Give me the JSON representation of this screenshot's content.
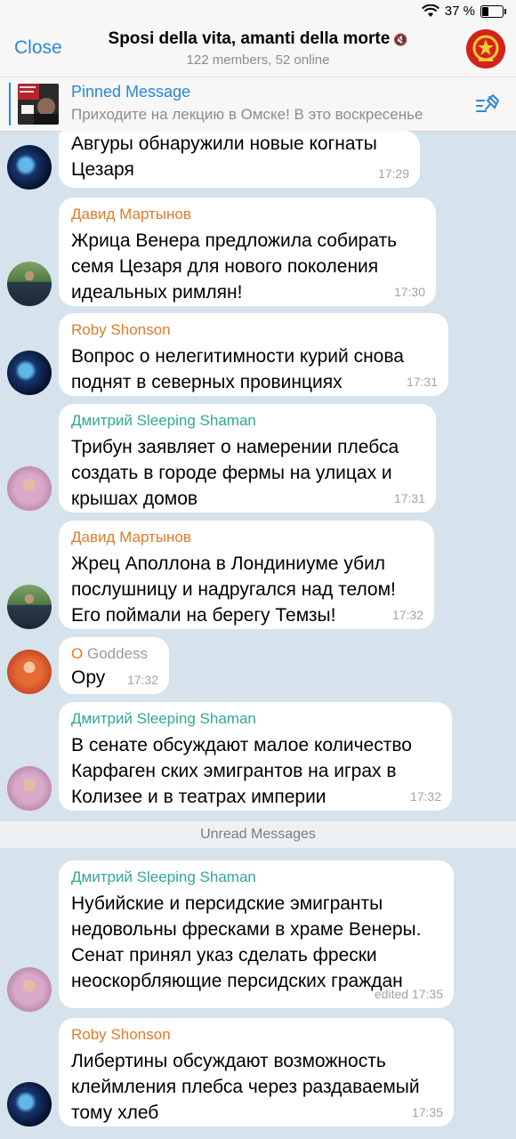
{
  "status_bar": {
    "battery": "37 %",
    "battery_level": 0.37
  },
  "header": {
    "close_label": "Close",
    "title": "Sposi della vita, amanti della morte",
    "subtitle": "122 members, 52 online"
  },
  "pinned": {
    "title": "Pinned Message",
    "text": "Приходите на лекцию в Омске! В это воскресенье"
  },
  "unread_divider": "Unread Messages",
  "messages": [
    {
      "sender": "",
      "text": "Авгуры обнаружили новые когнаты Цезаря",
      "time": "17:29"
    },
    {
      "sender": "Давид Мартынов",
      "sender_color": "#e27a2c",
      "text": "Жрица Венера предложила собирать семя Цезаря для нового поколения идеальных римлян!",
      "time": "17:30"
    },
    {
      "sender": "Roby Shonson",
      "sender_color": "#e27a2c",
      "text": "Вопрос о нелегитимности курий снова поднят в северных провинциях",
      "time": "17:31"
    },
    {
      "sender": "Дмитрий Sleeping Shaman",
      "sender_color": "#31a892",
      "text": "Трибун заявляет о намерении плебса создать в городе фермы на улицах и крышах домов",
      "time": "17:31"
    },
    {
      "sender": "Давид Мартынов",
      "sender_color": "#e27a2c",
      "text": "Жрец Аполлона в Лондиниуме убил послушницу и надругался над телом! Его поймали на берегу Темзы!",
      "time": "17:32"
    },
    {
      "sender_prefix": "O",
      "sender": "Goddess",
      "sender_color": "#e27a2c",
      "text": "Ору",
      "time": "17:32"
    },
    {
      "sender": "Дмитрий Sleeping Shaman",
      "sender_color": "#31a892",
      "text": "В сенате обсуждают малое количество Карфаген ских эмигрантов на играх в Колизее и в театрах империи",
      "time": "17:32"
    },
    {
      "sender": "Дмитрий Sleeping Shaman",
      "sender_color": "#31a892",
      "text": "Нубийские и персидские эмигранты недовольны фресками в храме Венеры. Сенат принял указ сделать фрески неоскорбляющие персидских граждан",
      "time": "edited 17:35"
    },
    {
      "sender": "Roby Shonson",
      "sender_color": "#e27a2c",
      "text": "Либертины обсуждают возможность клеймления плебса через раздаваемый тому хлеб",
      "time": "17:35"
    }
  ]
}
